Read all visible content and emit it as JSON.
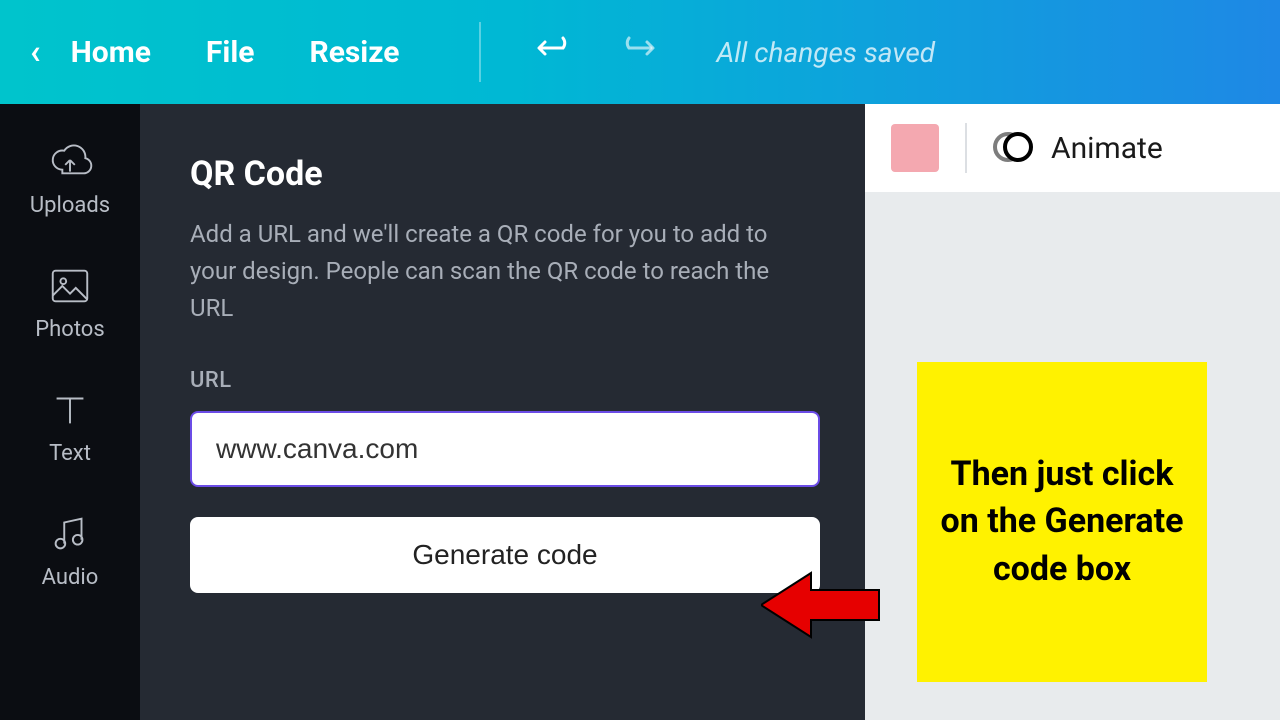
{
  "topbar": {
    "home": "Home",
    "file": "File",
    "resize": "Resize",
    "status": "All changes saved"
  },
  "rail": {
    "uploads": "Uploads",
    "photos": "Photos",
    "text": "Text",
    "audio": "Audio"
  },
  "panel": {
    "title": "QR Code",
    "description": "Add a URL and we'll create a QR code for you to add to your design. People can scan the QR code to reach the URL",
    "url_label": "URL",
    "url_value": "www.canva.com",
    "generate_label": "Generate code"
  },
  "canvas": {
    "swatch_color": "#f4a8b0",
    "animate_label": "Animate"
  },
  "annotation": {
    "note": "Then just click on the Generate code box"
  }
}
